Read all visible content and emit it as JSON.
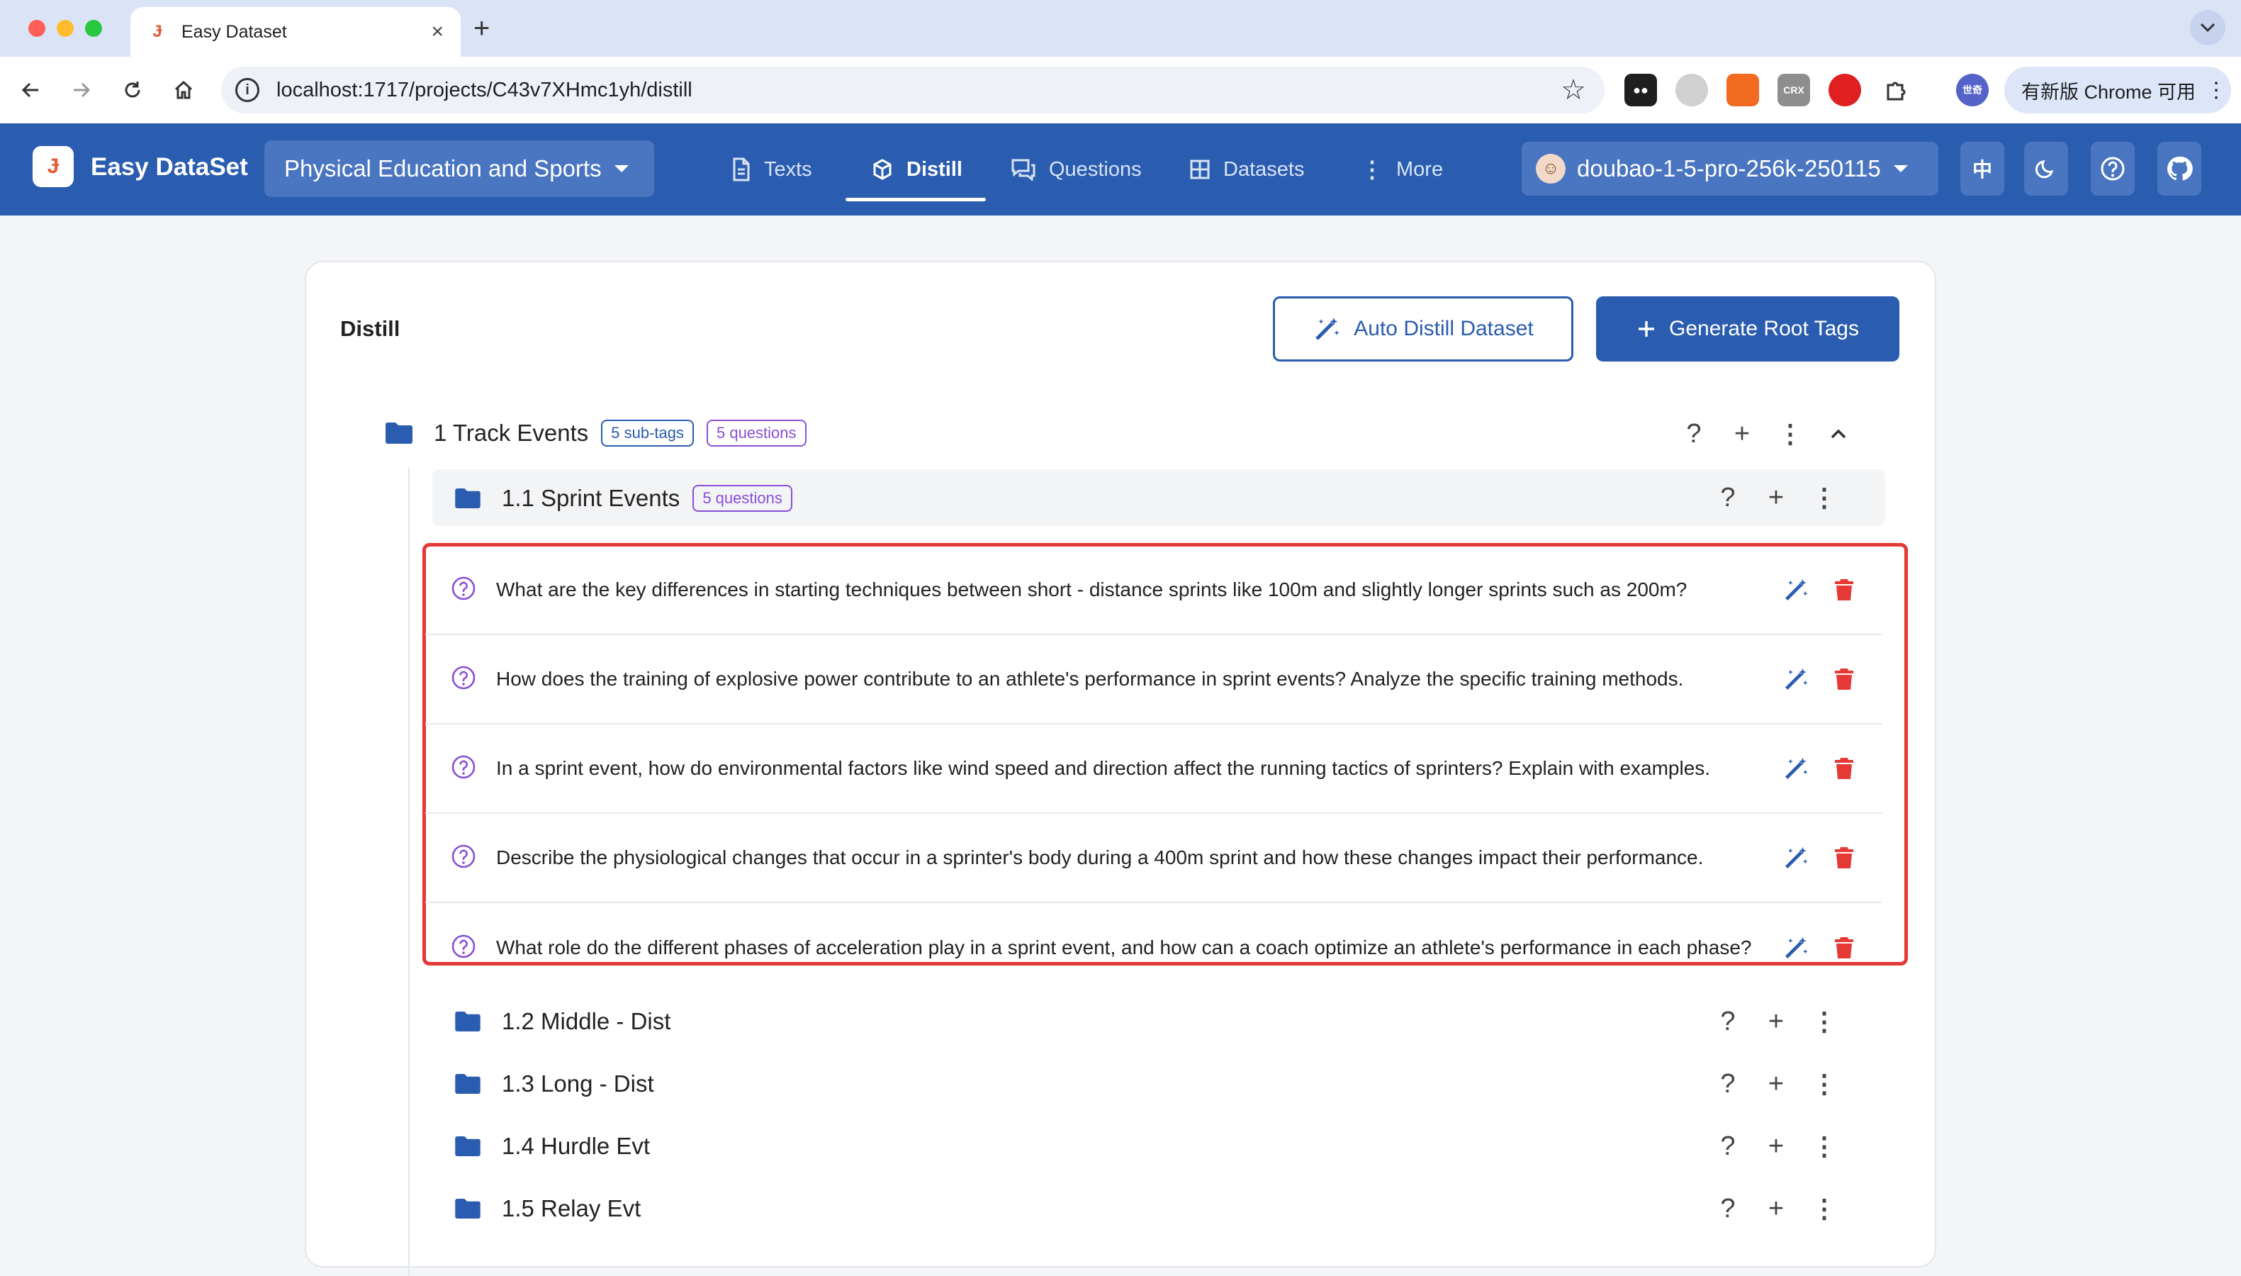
{
  "browser": {
    "tab_title": "Easy Dataset",
    "url": "localhost:1717/projects/C43v7XHmc1yh/distill",
    "update_label": "有新版 Chrome 可用",
    "extensions": [
      "CRX"
    ],
    "profile_label": "世奇"
  },
  "app": {
    "name": "Easy DataSet",
    "logo_glyph": "Ɉ",
    "project": "Physical Education and Sports",
    "nav": [
      {
        "label": "Texts",
        "icon": "document-icon"
      },
      {
        "label": "Distill",
        "icon": "cube-icon",
        "active": true
      },
      {
        "label": "Questions",
        "icon": "chat-icon"
      },
      {
        "label": "Datasets",
        "icon": "grid-icon"
      },
      {
        "label": "More",
        "icon": "more-vertical-icon"
      }
    ],
    "model": "doubao-1-5-pro-256k-250115",
    "lang_label": "中"
  },
  "distill": {
    "title": "Distill",
    "auto_button": "Auto Distill Dataset",
    "root_button": "Generate Root Tags",
    "root_tag": {
      "name": "1 Track Events",
      "subtags_chip": "5 sub-tags",
      "questions_chip": "5 questions"
    },
    "sub_tag": {
      "name": "1.1 Sprint Events",
      "questions_chip": "5 questions"
    },
    "questions": [
      "What are the key differences in starting techniques between short - distance sprints like 100m and slightly longer sprints such as 200m?",
      "How does the training of explosive power contribute to an athlete's performance in sprint events? Analyze the specific training methods.",
      "In a sprint event, how do environmental factors like wind speed and direction affect the running tactics of sprinters? Explain with examples.",
      "Describe the physiological changes that occur in a sprinter's body during a 400m sprint and how these changes impact their performance.",
      "What role do the different phases of acceleration play in a sprint event, and how can a coach optimize an athlete's performance in each phase?"
    ],
    "other_subtags": [
      "1.2 Middle - Dist",
      "1.3 Long - Dist",
      "1.4 Hurdle Evt",
      "1.5 Relay Evt"
    ]
  },
  "colors": {
    "primary": "#2a5cb0",
    "delete": "#e53935",
    "question_icon": "#8a4fd6",
    "highlight": "#e53935"
  }
}
